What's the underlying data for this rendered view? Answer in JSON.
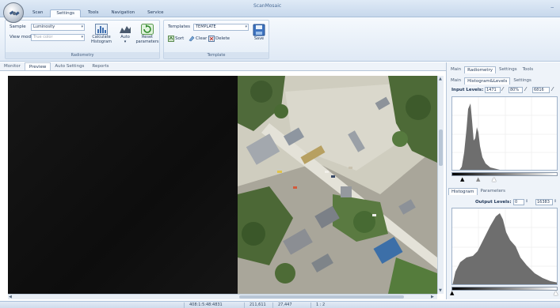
{
  "app": {
    "title": "ScanMosaic",
    "minimize_glyph": "_"
  },
  "ribbon_tabs": [
    "Scan",
    "Settings",
    "Tools",
    "Navigation",
    "Service"
  ],
  "active_ribbon_tab": "Settings",
  "radiometry": {
    "sample_label": "Sample",
    "sample_value": "Luminosity",
    "viewmode_label": "View mode",
    "viewmode_value": "True color",
    "calc_histogram": "Calculate Histogram",
    "auto": "Auto",
    "reset": "Reset parameters",
    "caption": "Radiometry"
  },
  "template": {
    "templates_label": "Templates",
    "templates_value": "TEMPLATE",
    "sort": "Sort",
    "clear": "Clear",
    "delete": "Delete",
    "save": "Save",
    "caption": "Template"
  },
  "view_tabs": [
    "Monitor",
    "Preview",
    "Auto Settings",
    "Reports"
  ],
  "active_view_tab": "Preview",
  "panel": {
    "top_tabs": [
      "Main",
      "Radiometry",
      "Settings",
      "Tools"
    ],
    "active_top_tab": "Radiometry",
    "sub_tabs": [
      "Main",
      "Histogram&Levels",
      "Settings"
    ],
    "active_sub_tab": "Histogram&Levels",
    "input_levels_label": "Input Levels:",
    "input_black": "1471",
    "input_gamma": "80%",
    "input_white": "6816",
    "bottom_tabs": [
      "Histogram",
      "Parameters"
    ],
    "active_bottom_tab": "Histogram",
    "output_levels_label": "Output Levels:",
    "output_black": "0",
    "output_white": "16383"
  },
  "status": {
    "coords": "408:1:5:48:4831",
    "value1": "211,611",
    "value2": "27,447",
    "zoom": "1 : 2"
  },
  "icons": {
    "orb": "satellite-icon",
    "calc": "histogram-calc-icon",
    "auto": "auto-levels-icon",
    "reset": "reset-icon",
    "sort": "sort-icon",
    "clear": "clear-icon",
    "delete": "delete-icon",
    "save": "save-icon"
  },
  "colors": {
    "ribbon_accent": "#c7d8ec",
    "histogram_fill": "#6e6e6e"
  }
}
